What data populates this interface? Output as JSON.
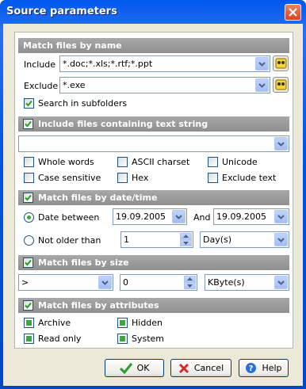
{
  "window": {
    "title": "Source parameters"
  },
  "name_section": {
    "header": "Match files by name",
    "include_label": "Include",
    "include_value": "*.doc;*.xls;*.rtf;*.ppt",
    "exclude_label": "Exclude",
    "exclude_value": "*.exe",
    "subfolders_label": "Search in subfolders",
    "subfolders_checked": true
  },
  "text_section": {
    "header": "Include files containing text string",
    "checked": true,
    "search_value": "",
    "options": {
      "whole_words": "Whole words",
      "ascii": "ASCII charset",
      "unicode": "Unicode",
      "case": "Case sensitive",
      "hex": "Hex",
      "exclude_text": "Exclude text"
    }
  },
  "date_section": {
    "header": "Match files by date/time",
    "checked": true,
    "between_label": "Date between",
    "from_date": "19.09.2005",
    "and_label": "And",
    "to_date": "19.09.2005",
    "older_label": "Not older than",
    "older_value": "1",
    "older_unit": "Day(s)",
    "selected": "between"
  },
  "size_section": {
    "header": "Match files by size",
    "checked": true,
    "operator": ">",
    "value": "0",
    "unit": "KByte(s)"
  },
  "attr_section": {
    "header": "Match files by attributes",
    "checked": true,
    "archive": "Archive",
    "hidden": "Hidden",
    "readonly": "Read only",
    "system": "System"
  },
  "buttons": {
    "ok": "OK",
    "cancel": "Cancel",
    "help": "Help"
  },
  "colors": {
    "title_bar": "#0054e3",
    "section_header": "#999999",
    "accent_green": "#3aa83a"
  }
}
